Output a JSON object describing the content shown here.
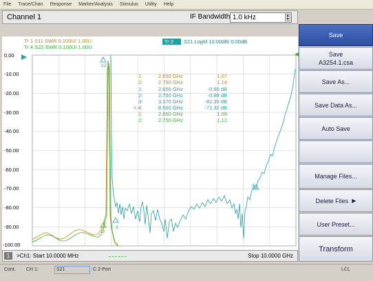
{
  "menu": [
    "File",
    "Trace/Chan",
    "Response",
    "Marker/Analysis",
    "Stimulus",
    "Utility",
    "Help"
  ],
  "header": {
    "channel_title": "Channel 1",
    "ifbw_label": "IF Bandwidth",
    "ifbw_value": "1.0 kHz"
  },
  "traces": {
    "tr1": "Tr  1  S11  SWR 0.100U/  1.00U",
    "tr4": "Tr  4  S22  SWR 0.100U/  1.00U",
    "tr2_badge": "Tr  2",
    "tr2_text": "S21  LogM  10.00dB/  0.00dB"
  },
  "y_axis": {
    "ticks": [
      "0.00",
      "-10.00",
      "-20.00",
      "-30.00",
      "-40.00",
      "-50.00",
      "-60.00",
      "-70.00",
      "-80.00",
      "-90.00",
      "-100.00"
    ]
  },
  "markers": [
    {
      "id": "1:",
      "freq": "2.650 GHz",
      "val": "1.07",
      "color": "#b8860b"
    },
    {
      "id": "2:",
      "freq": "2.750 GHz",
      "val": "1.14",
      "color": "#b8860b"
    },
    {
      "id": "1:",
      "freq": "2.650 GHz",
      "val": "-0.66 dB",
      "color": "#20a0a0"
    },
    {
      "id": "2:",
      "freq": "2.750 GHz",
      "val": "-0.88 dB",
      "color": "#20a0a0"
    },
    {
      "id": "3:",
      "freq": "3.170 GHz",
      "val": "-81.39 dB",
      "color": "#20a0a0"
    },
    {
      "id": "> 4:",
      "freq": "8.500 GHz",
      "val": "-71.32 dB",
      "color": "#20a0a0"
    },
    {
      "id": "1:",
      "freq": "2.650 GHz",
      "val": "1.09",
      "color": "#30b030"
    },
    {
      "id": "2:",
      "freq": "2.750 GHz",
      "val": "1.12",
      "color": "#30b030"
    }
  ],
  "marker_tags": {
    "m12": "12",
    "m3": "3",
    "m4": "4",
    "m_left": "12"
  },
  "bottom": {
    "channel_num": "1",
    "start": ">Ch1: Start  10.0000 MHz",
    "stop": "Stop  10.0000 GHz"
  },
  "sidebar": {
    "save": "Save",
    "save_file_1": "Save",
    "save_file_2": "A3254.1.csa",
    "save_as": "Save As...",
    "save_data_as": "Save Data As...",
    "auto_save": "Auto Save",
    "manage_files": "Manage Files...",
    "delete_files": "Delete Files",
    "user_preset": "User Preset...",
    "transform": "Transform"
  },
  "status": {
    "mode": "Cont.",
    "channel": "CH 1:",
    "param": "S21",
    "port": "C  2-Port",
    "lcl": "LCL"
  },
  "colors": {
    "s11": "#b8860b",
    "s22": "#30b030",
    "s21": "#20a0a0",
    "active_button": "#3a5cb0"
  }
}
